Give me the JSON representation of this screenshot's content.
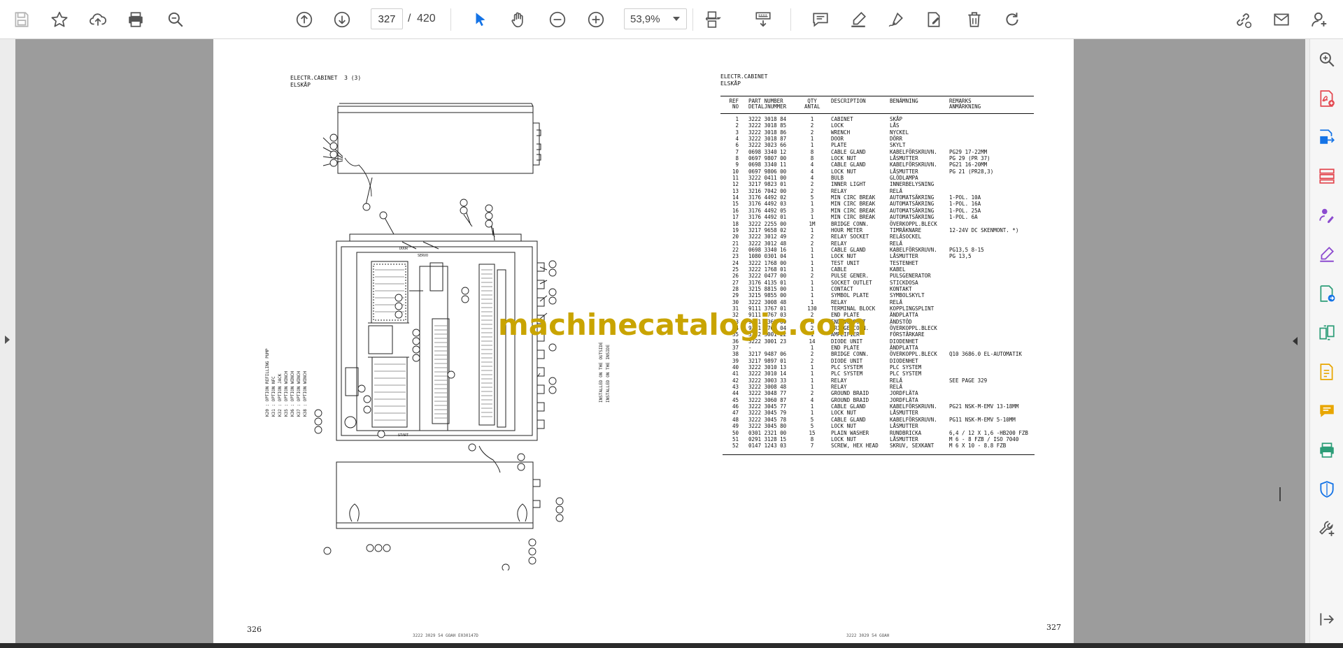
{
  "toolbar": {
    "current_page": "327",
    "page_separator": "/",
    "total_pages": "420",
    "zoom": "53,9%"
  },
  "left_page": {
    "title_line1": "ELECTR.CABINET  3 (3)",
    "title_line2": "ELSKÅP",
    "page_number": "326",
    "footer_code": "3222 3029 54  GOAH  E030147D",
    "legend": [
      "K20 : OPTION REFILLING PUMP",
      "K31 : OPTION NFC",
      "K32 : OPTION JACK",
      "K35 : OPTION WINCH",
      "K36 : OPTION WINCH",
      "K37 : OPTION WINCH",
      "K38 : OPTION WINCH"
    ],
    "rotated_note": "INSTALLED ON THE OUTSIDE / ON THE INSIDE",
    "callouts": [
      "15",
      "16",
      "17",
      "43",
      "38",
      "23",
      "22",
      "21",
      "12",
      "19",
      "20",
      "36",
      "29",
      "30",
      "44",
      "45",
      "46",
      "48",
      "47",
      "49",
      "10",
      "9",
      "11",
      "16",
      "31",
      "33",
      "40",
      "37",
      "26",
      "28",
      "13",
      "32",
      "14",
      "15",
      "50",
      "25",
      "34",
      "18",
      "52",
      "39",
      "47",
      "48",
      "52",
      "51",
      "42",
      "24",
      "25",
      "51",
      "50",
      "42"
    ]
  },
  "right_page": {
    "title_line1": "ELECTR.CABINET",
    "title_line2": "ELSKÅP",
    "page_number": "327",
    "footer_code": "3222 3029 54  GOAH",
    "headers": {
      "ref": "REF\nNO",
      "part": "PART NUMBER\nDETALJNUMMER",
      "qty": "QTY\nANTAL",
      "desc": "DESCRIPTION",
      "ben": "BENÄMNING",
      "rem": "REMARKS\nANMÄRKNING"
    },
    "rows": [
      {
        "ref": "1",
        "part": "3222 3018 84",
        "qty": "1",
        "desc": "CABINET",
        "ben": "SKÅP",
        "rem": ""
      },
      {
        "ref": "2",
        "part": "3222 3018 85",
        "qty": "2",
        "desc": "LOCK",
        "ben": "LÅS",
        "rem": ""
      },
      {
        "ref": "3",
        "part": "3222 3018 86",
        "qty": "2",
        "desc": "WRENCH",
        "ben": "NYCKEL",
        "rem": ""
      },
      {
        "ref": "4",
        "part": "3222 3018 87",
        "qty": "1",
        "desc": "DOOR",
        "ben": "DÖRR",
        "rem": ""
      },
      {
        "ref": "6",
        "part": "3222 3023 66",
        "qty": "1",
        "desc": "PLATE",
        "ben": "SKYLT",
        "rem": ""
      },
      {
        "ref": "7",
        "part": "0698 3340 12",
        "qty": "8",
        "desc": "CABLE GLAND",
        "ben": "KABELFÖRSKRUVN.",
        "rem": "PG29  17-22MM"
      },
      {
        "ref": "8",
        "part": "0697 9807 00",
        "qty": "8",
        "desc": "LOCK NUT",
        "ben": "LÅSMUTTER",
        "rem": "PG 29 (PR 37)"
      },
      {
        "ref": "9",
        "part": "0698 3340 11",
        "qty": "4",
        "desc": "CABLE GLAND",
        "ben": "KABELFÖRSKRUVN.",
        "rem": "PG21  16-20MM"
      },
      {
        "ref": "10",
        "part": "0697 9806 00",
        "qty": "4",
        "desc": "LOCK NUT",
        "ben": "LÅSMUTTER",
        "rem": "PG 21 (PR28,3)"
      },
      {
        "ref": "11",
        "part": "3222 0411 00",
        "qty": "4",
        "desc": "BULB",
        "ben": "GLÖDLAMPA",
        "rem": ""
      },
      {
        "ref": "12",
        "part": "3217 9823 01",
        "qty": "2",
        "desc": "INNER LIGHT",
        "ben": "INNERBELYSNING",
        "rem": ""
      },
      {
        "ref": "13",
        "part": "3216 7042 00",
        "qty": "2",
        "desc": "RELAY",
        "ben": "RELÄ",
        "rem": ""
      },
      {
        "ref": "14",
        "part": "3176 4492 02",
        "qty": "5",
        "desc": "MIN CIRC BREAK",
        "ben": "AUTOMATSÄKRING",
        "rem": "1-POL. 10A"
      },
      {
        "ref": "15",
        "part": "3176 4492 03",
        "qty": "1",
        "desc": "MIN CIRC BREAK",
        "ben": "AUTOMATSÄKRING",
        "rem": "1-POL. 16A"
      },
      {
        "ref": "16",
        "part": "3176 4492 05",
        "qty": "3",
        "desc": "MIN CIRC BREAK",
        "ben": "AUTOMATSÄKRING",
        "rem": "1-POL. 25A"
      },
      {
        "ref": "17",
        "part": "3176 4492 01",
        "qty": "1",
        "desc": "MIN CIRC BREAK",
        "ben": "AUTOMATSÄKRING",
        "rem": "1-POL.  6A"
      },
      {
        "ref": "18",
        "part": "3222 2255 00",
        "qty": "1M",
        "desc": "BRIDGE CONN.",
        "ben": "ÖVERKOPPL.BLECK",
        "rem": ""
      },
      {
        "ref": "19",
        "part": "3217 9658 02",
        "qty": "1",
        "desc": "HOUR METER",
        "ben": "TIMRÄKNARE",
        "rem": "12-24V DC SKENMONT. *)"
      },
      {
        "ref": "20",
        "part": "3222 3012 49",
        "qty": "2",
        "desc": "RELAY SOCKET",
        "ben": "RELÄSOCKEL",
        "rem": ""
      },
      {
        "ref": "21",
        "part": "3222 3012 48",
        "qty": "2",
        "desc": "RELAY",
        "ben": "RELÄ",
        "rem": ""
      },
      {
        "ref": "22",
        "part": "0698 3340 16",
        "qty": "1",
        "desc": "CABLE GLAND",
        "ben": "KABELFÖRSKRUVN.",
        "rem": "PG13,5  8-15"
      },
      {
        "ref": "23",
        "part": "1080 0301 04",
        "qty": "1",
        "desc": "LOCK NUT",
        "ben": "LÅSMUTTER",
        "rem": "PG 13,5"
      },
      {
        "ref": "24",
        "part": "3222 1768 00",
        "qty": "1",
        "desc": "TEST UNIT",
        "ben": "TESTENHET",
        "rem": ""
      },
      {
        "ref": "25",
        "part": "3222 1768 01",
        "qty": "1",
        "desc": "CABLE",
        "ben": "KABEL",
        "rem": ""
      },
      {
        "ref": "26",
        "part": "3222 0477 00",
        "qty": "2",
        "desc": "PULSE GENER.",
        "ben": "PULSGENERATOR",
        "rem": ""
      },
      {
        "ref": "27",
        "part": "3176 4135 01",
        "qty": "1",
        "desc": "SOCKET OUTLET",
        "ben": "STICKDOSA",
        "rem": ""
      },
      {
        "ref": "28",
        "part": "3215 8815 00",
        "qty": "1",
        "desc": "CONTACT",
        "ben": "KONTAKT",
        "rem": ""
      },
      {
        "ref": "29",
        "part": "3215 9855 00",
        "qty": "1",
        "desc": "SYMBOL PLATE",
        "ben": "SYMBOLSKYLT",
        "rem": ""
      },
      {
        "ref": "30",
        "part": "3222 3008 48",
        "qty": "1",
        "desc": "RELAY",
        "ben": "RELÄ",
        "rem": ""
      },
      {
        "ref": "31",
        "part": "9111 3767 01",
        "qty": "130",
        "desc": "TERMINAL BLOCK",
        "ben": "KOPPLINGSPLINT",
        "rem": ""
      },
      {
        "ref": "32",
        "part": "9111 3767 03",
        "qty": "2",
        "desc": "END PLATE",
        "ben": "ÄNDPLATTA",
        "rem": ""
      },
      {
        "ref": "33",
        "part": "9111 4363 00",
        "qty": "2",
        "desc": "END SUPPORT",
        "ben": "ÄNDSTÖD",
        "rem": ""
      },
      {
        "ref": "34",
        "part": "9111 3767 04",
        "qty": "2",
        "desc": "BRIDGE CONN.",
        "ben": "ÖVERKOPPL.BLECK",
        "rem": ""
      },
      {
        "ref": "35",
        "part": "3222 3001 22",
        "qty": "1",
        "desc": "AMPLIFIER",
        "ben": "FÖRSTÄRKARE",
        "rem": ""
      },
      {
        "ref": "36",
        "part": "3222 3001 23",
        "qty": "14",
        "desc": "DIODE UNIT",
        "ben": "DIODENHET",
        "rem": ""
      },
      {
        "ref": "37",
        "part": "-",
        "qty": "1",
        "desc": "END PLATE",
        "ben": "ÄNDPLATTA",
        "rem": ""
      },
      {
        "ref": "38",
        "part": "3217 9487 06",
        "qty": "2",
        "desc": "BRIDGE CONN.",
        "ben": "ÖVERKOPPL.BLECK",
        "rem": "Q10  3686.0 EL-AUTOMATIK"
      },
      {
        "ref": "39",
        "part": "3217 9897 01",
        "qty": "2",
        "desc": "DIODE UNIT",
        "ben": "DIODENHET",
        "rem": ""
      },
      {
        "ref": "40",
        "part": "3222 3010 13",
        "qty": "1",
        "desc": "PLC SYSTEM",
        "ben": "PLC SYSTEM",
        "rem": ""
      },
      {
        "ref": "41",
        "part": "3222 3010 14",
        "qty": "1",
        "desc": "PLC SYSTEM",
        "ben": "PLC SYSTEM",
        "rem": ""
      },
      {
        "ref": "42",
        "part": "3222 3003 33",
        "qty": "1",
        "desc": "RELAY",
        "ben": "RELÄ",
        "rem": "SEE PAGE 329"
      },
      {
        "ref": "43",
        "part": "3222 3008 48",
        "qty": "1",
        "desc": "RELAY",
        "ben": "RELÄ",
        "rem": ""
      },
      {
        "ref": "44",
        "part": "3222 3048 77",
        "qty": "2",
        "desc": "GROUND BRAID",
        "ben": "JORDFLÄTA",
        "rem": ""
      },
      {
        "ref": "45",
        "part": "3222 3060 87",
        "qty": "4",
        "desc": "GROUND BRAID",
        "ben": "JORDFLÄTA",
        "rem": ""
      },
      {
        "ref": "46",
        "part": "3222 3045 77",
        "qty": "1",
        "desc": "CABLE GLAND",
        "ben": "KABELFÖRSKRUVN.",
        "rem": "PG21 NSK-M-EMV 13-18MM"
      },
      {
        "ref": "47",
        "part": "3222 3045 79",
        "qty": "1",
        "desc": "LOCK NUT",
        "ben": "LÅSMUTTER",
        "rem": ""
      },
      {
        "ref": "48",
        "part": "3222 3045 78",
        "qty": "5",
        "desc": "CABLE GLAND",
        "ben": "KABELFÖRSKRUVN.",
        "rem": "PG11 NSK-M-EMV 5-10MM"
      },
      {
        "ref": "49",
        "part": "3222 3045 80",
        "qty": "5",
        "desc": "LOCK NUT",
        "ben": "LÅSMUTTER",
        "rem": ""
      },
      {
        "ref": "50",
        "part": "0301 2321 00",
        "qty": "15",
        "desc": "PLAIN WASHER",
        "ben": "RUNDBRICKA",
        "rem": "6,4 / 12 X 1,6 -HB200 FZB"
      },
      {
        "ref": "51",
        "part": "0291 3128 15",
        "qty": "8",
        "desc": "LOCK NUT",
        "ben": "LÅSMUTTER",
        "rem": "M  6 - 8 FZB / ISO 7040"
      },
      {
        "ref": "52",
        "part": "0147 1243 03",
        "qty": "7",
        "desc": "SCREW, HEX HEAD",
        "ben": "SKRUV, SEXKANT",
        "rem": "M  6 X 10 - 8.8 FZB"
      }
    ]
  },
  "watermark": "machinecatalogic.com",
  "colors": {
    "accent_blue": "#1473e6",
    "sidebar_red": "#e34850",
    "sidebar_purple": "#8c4bcf",
    "sidebar_green": "#2d9d78",
    "sidebar_yellow": "#e8a600",
    "watermark": "#c9a400"
  }
}
